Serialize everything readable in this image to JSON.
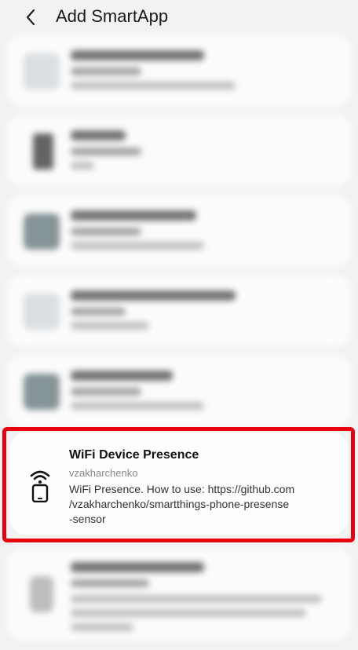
{
  "header": {
    "title": "Add SmartApp"
  },
  "highlighted_app": {
    "name": "WiFi Device Presence",
    "author": "vzakharchenko",
    "description_lines": [
      "WiFi Presence. How to use: https://github.com",
      "/vzakharchenko/smartthings-phone-presense",
      "-sensor"
    ]
  },
  "colors": {
    "highlight_border": "#e8000f",
    "background": "#f2f2f2",
    "card": "#fcfcfc"
  },
  "icons": {
    "back": "chevron-left-icon",
    "wifi_phone": "wifi-phone-icon"
  }
}
